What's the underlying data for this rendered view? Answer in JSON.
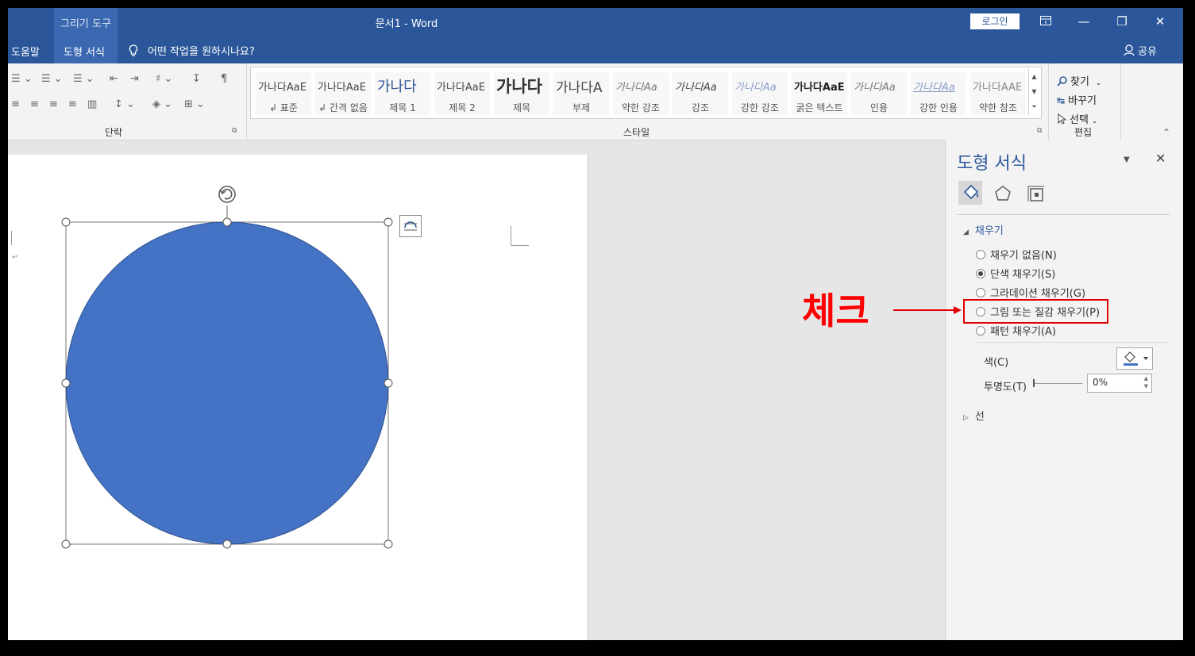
{
  "title_bar": {
    "context_tab_group": "그리기 도구",
    "document_title": "문서1  -  Word",
    "login_label": "로그인",
    "ribbon_display_icon": "ribbon-display-icon",
    "minimize_glyph": "—",
    "restore_glyph": "❐",
    "close_glyph": "✕"
  },
  "menu": {
    "help": "도움말",
    "shape_format": "도형 서식",
    "tell_me": "어떤 작업을 원하시나요?",
    "share": "공유"
  },
  "ribbon": {
    "paragraph_label": "단락",
    "styles_label": "스타일",
    "editing_label": "편집",
    "styles": [
      {
        "sample": "가나다AaE",
        "name": "↲ 표준"
      },
      {
        "sample": "가나다AaE",
        "name": "↲ 간격 없음"
      },
      {
        "sample": "가나다",
        "name": "제목 1"
      },
      {
        "sample": "가나다AaE",
        "name": "제목 2"
      },
      {
        "sample": "가나다",
        "name": "제목"
      },
      {
        "sample": "가나다A",
        "name": "부제"
      },
      {
        "sample": "가나다Aa",
        "name": "약한 강조"
      },
      {
        "sample": "가나다Aa",
        "name": "강조"
      },
      {
        "sample": "가나다Aa",
        "name": "강한 강조"
      },
      {
        "sample": "가나다AaE",
        "name": "굵은 텍스트"
      },
      {
        "sample": "가나다Aa",
        "name": "인용"
      },
      {
        "sample": "가나다Aa",
        "name": "강한 인용"
      },
      {
        "sample": "가나다AAE",
        "name": "약한 참조"
      }
    ],
    "editing": {
      "find": "찾기",
      "replace": "바꾸기",
      "select": "선택"
    }
  },
  "pane": {
    "title": "도형 서식",
    "fill_section": "채우기",
    "fill_options": [
      {
        "label": "채우기 없음(N)",
        "selected": false
      },
      {
        "label": "단색 채우기(S)",
        "selected": true
      },
      {
        "label": "그라데이션 채우기(G)",
        "selected": false
      },
      {
        "label": "그림 또는 질감 채우기(P)",
        "selected": false
      },
      {
        "label": "패턴 채우기(A)",
        "selected": false
      }
    ],
    "color_label": "색(C)",
    "transparency_label": "투명도(T)",
    "transparency_value": "0%",
    "line_section": "선"
  },
  "annotation": {
    "text": "체크",
    "color": "#ff0000"
  },
  "colors": {
    "word_blue": "#2b579a",
    "shape_fill": "#4472c4"
  }
}
